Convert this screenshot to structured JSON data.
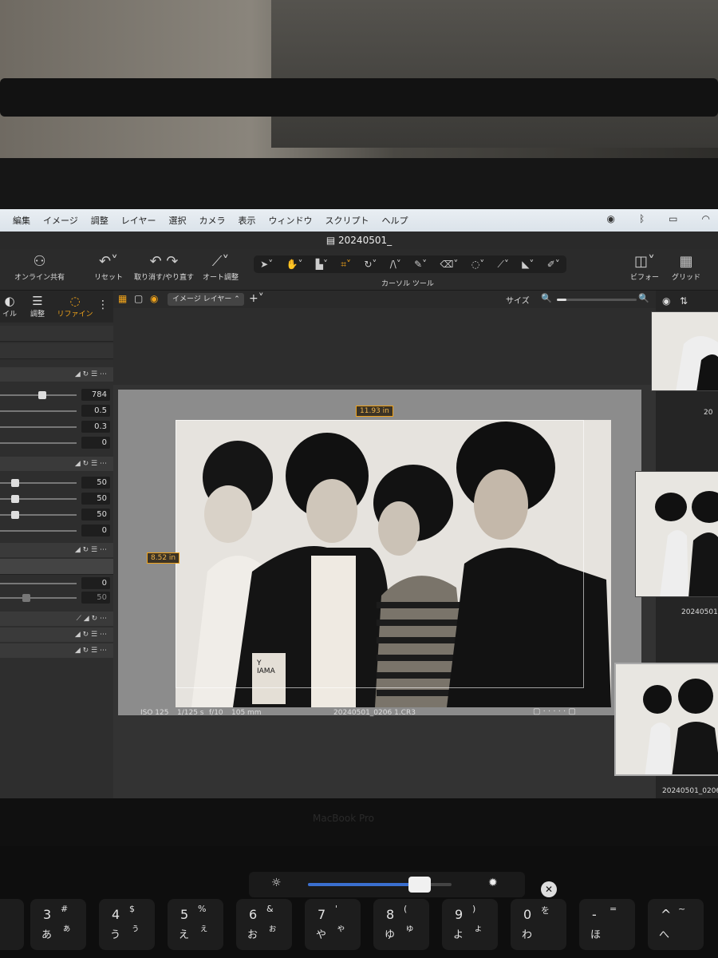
{
  "menubar": {
    "items": [
      "編集",
      "イメージ",
      "調整",
      "レイヤー",
      "選択",
      "カメラ",
      "表示",
      "ウィンドウ",
      "スクリプト",
      "ヘルプ"
    ]
  },
  "window": {
    "title": "20240501_"
  },
  "toolbar": {
    "share": "オンライン共有",
    "reset": "リセット",
    "undo_redo": "取り消す/やり直す",
    "auto_adjust": "オート調整",
    "cursor_tools": "カーソル ツール",
    "before": "ビフォー",
    "grid": "グリッド"
  },
  "left_panel": {
    "tabs": [
      "イル",
      "調整",
      "リファイン"
    ],
    "group1_values": [
      "784",
      "0.5",
      "0.3",
      "0"
    ],
    "group2_values": [
      "50",
      "50",
      "50",
      "0"
    ],
    "group3_values": [
      "0",
      "50"
    ]
  },
  "viewer": {
    "layer_select": "イメージ レイヤー",
    "size_label": "サイズ",
    "zoom_level": 0.12,
    "crop_width": "11.93 in",
    "crop_height": "8.52 in",
    "photo_text": "Y\nIAMA",
    "iso": "ISO 125",
    "shutter": "1/125 s",
    "aperture": "f/10",
    "focal": "105 mm",
    "filename": "20240501_0206 1.CR3"
  },
  "browser": {
    "labels": [
      "20",
      "20240501",
      "20240501_0206"
    ]
  },
  "hardware": {
    "bezel": "MacBook Pro",
    "brightness": 0.78,
    "keys": [
      {
        "main": "3",
        "sym": "#",
        "kana": "あ",
        "kana2": "ぁ"
      },
      {
        "main": "4",
        "sym": "$",
        "kana": "う",
        "kana2": "ぅ"
      },
      {
        "main": "5",
        "sym": "%",
        "kana": "え",
        "kana2": "ぇ"
      },
      {
        "main": "6",
        "sym": "&",
        "kana": "お",
        "kana2": "ぉ"
      },
      {
        "main": "7",
        "sym": "'",
        "kana": "や",
        "kana2": "ゃ"
      },
      {
        "main": "8",
        "sym": "(",
        "kana": "ゆ",
        "kana2": "ゅ"
      },
      {
        "main": "9",
        "sym": ")",
        "kana": "よ",
        "kana2": "ょ"
      },
      {
        "main": "0",
        "sym": "",
        "kana": "わ",
        "kana2": "を"
      },
      {
        "main": "-",
        "sym": "=",
        "kana": "ほ",
        "kana2": ""
      },
      {
        "main": "^",
        "sym": "~",
        "kana": "へ",
        "kana2": ""
      }
    ]
  }
}
